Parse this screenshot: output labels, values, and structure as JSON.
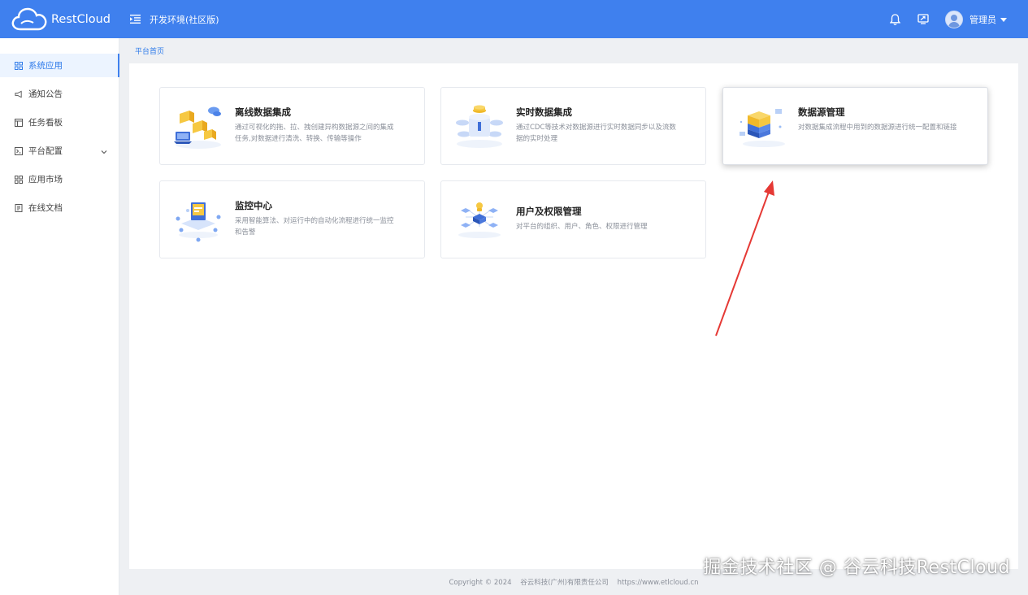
{
  "header": {
    "logo_text": "RestCloud",
    "env_title": "开发环境(社区版)",
    "user_name": "管理员",
    "brand_color": "#3f80ee",
    "icons": [
      "menu-fold-icon",
      "bell-icon",
      "screen-share-icon",
      "user-avatar-icon",
      "caret-down-icon"
    ]
  },
  "sidebar": {
    "items": [
      {
        "label": "系统应用",
        "icon": "apps-grid-icon",
        "active": true
      },
      {
        "label": "通知公告",
        "icon": "megaphone-icon"
      },
      {
        "label": "任务看板",
        "icon": "board-icon"
      },
      {
        "label": "平台配置",
        "icon": "terminal-icon",
        "has_submenu": true
      },
      {
        "label": "应用市场",
        "icon": "apps-grid-icon"
      },
      {
        "label": "在线文档",
        "icon": "document-icon"
      }
    ]
  },
  "breadcrumb": "平台首页",
  "cards": [
    {
      "title": "离线数据集成",
      "desc": "通过可视化的拖、拉、拽创建异构数据源之间的集成任务,对数据进行清洗、转换、传输等操作"
    },
    {
      "title": "实时数据集成",
      "desc": "通过CDC等技术对数据源进行实时数据同步以及流数据的实时处理"
    },
    {
      "title": "数据源管理",
      "desc": "对数据集成流程中用到的数据源进行统一配置和链接"
    },
    {
      "title": "监控中心",
      "desc": "采用智能算法、对运行中的自动化流程进行统一监控和告警"
    },
    {
      "title": "用户及权限管理",
      "desc": "对平台的组织、用户、角色、权限进行管理"
    }
  ],
  "footer": {
    "copyright": "Copyright © 2024",
    "company": "谷云科技(广州)有限责任公司",
    "url": "https://www.etlcloud.cn"
  },
  "watermark": "掘金技术社区 @ 谷云科技RestCloud",
  "annotation_color": "#e53935"
}
